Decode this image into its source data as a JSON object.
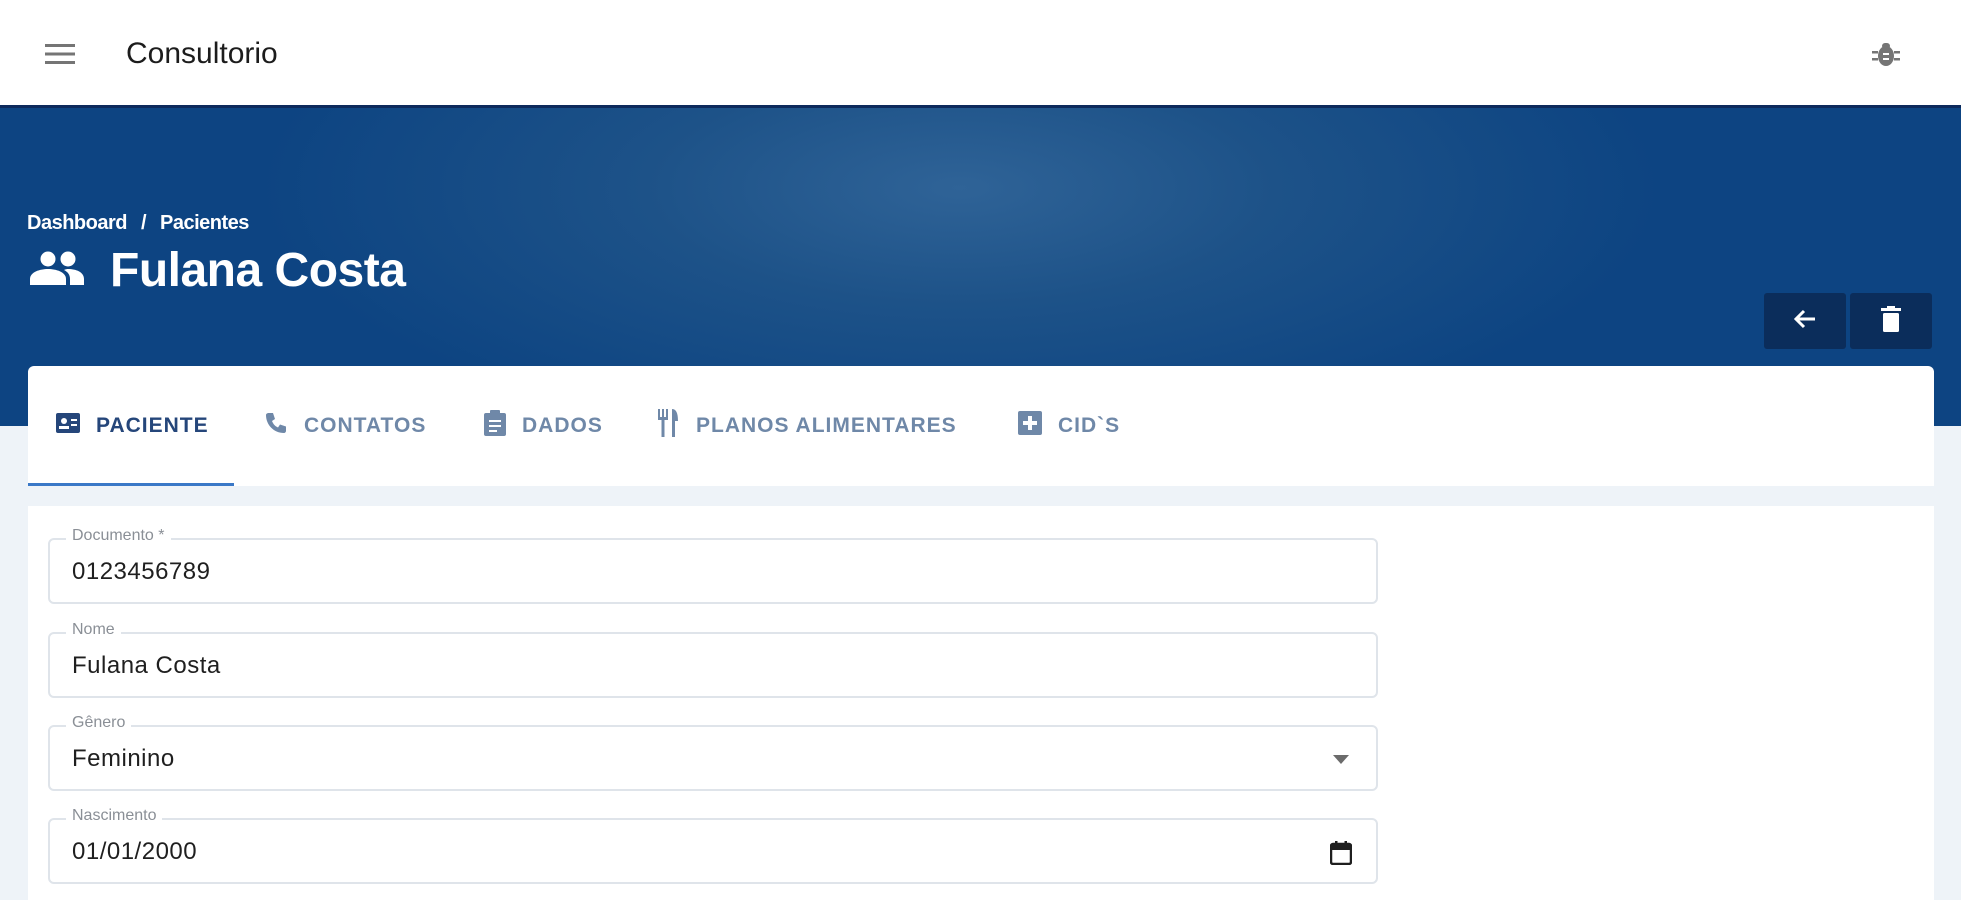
{
  "app": {
    "title": "Consultorio"
  },
  "colors": {
    "hero_gradient_center": "#2f6397",
    "hero_gradient_edge": "#0d4482",
    "action_button_bg": "#0b2d5b",
    "tab_active": "#25467a",
    "tab_inactive": "#6f88a8",
    "tab_indicator": "#3a78c7"
  },
  "topbar": {
    "menu_icon": "hamburger-menu-icon",
    "debug_icon": "bug-icon"
  },
  "breadcrumb": {
    "items": [
      "Dashboard",
      "Pacientes"
    ],
    "separator": "/"
  },
  "page": {
    "title": "Fulana Costa",
    "icon": "people-icon"
  },
  "actions": {
    "back_icon": "arrow-left-icon",
    "delete_icon": "trash-icon"
  },
  "tabs": [
    {
      "label": "PACIENTE",
      "icon": "id-card-icon",
      "active": true
    },
    {
      "label": "CONTATOS",
      "icon": "phone-icon",
      "active": false
    },
    {
      "label": "DADOS",
      "icon": "clipboard-icon",
      "active": false
    },
    {
      "label": "PLANOS ALIMENTARES",
      "icon": "fork-knife-icon",
      "active": false
    },
    {
      "label": "CID`S",
      "icon": "medical-box-icon",
      "active": false
    }
  ],
  "form": {
    "fields": [
      {
        "label": "Documento *",
        "value": "0123456789",
        "type": "text"
      },
      {
        "label": "Nome",
        "value": "Fulana Costa",
        "type": "text"
      },
      {
        "label": "Gênero",
        "value": "Feminino",
        "type": "select"
      },
      {
        "label": "Nascimento",
        "value": "01/01/2000",
        "type": "date"
      }
    ]
  }
}
